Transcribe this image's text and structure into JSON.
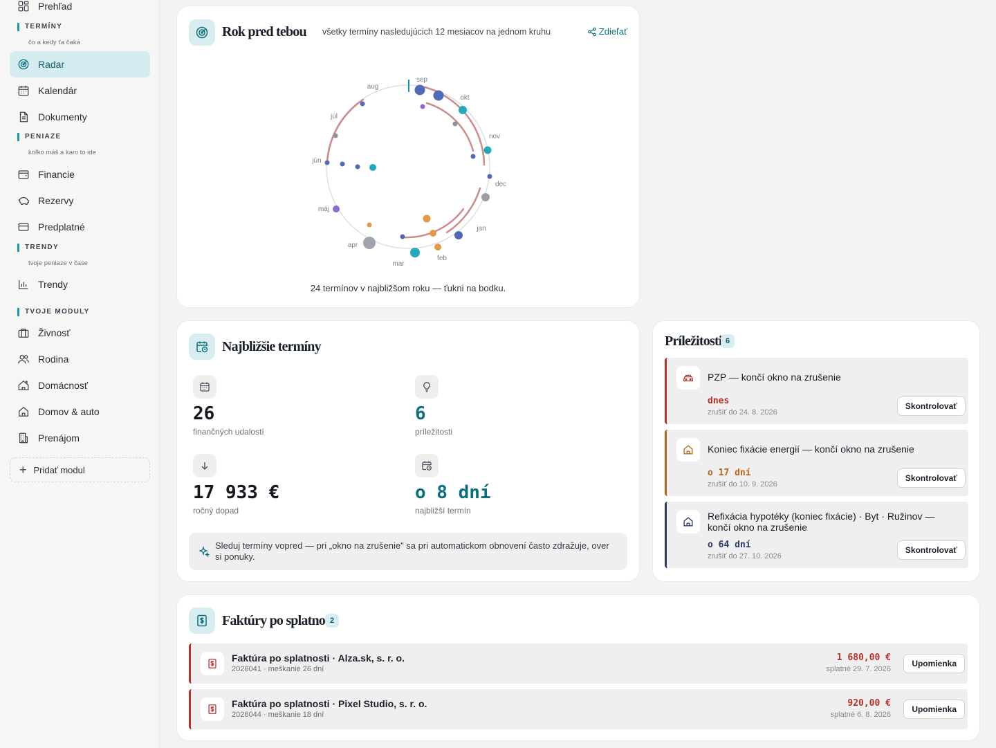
{
  "sidebar": {
    "top_item": "Prehľad",
    "sections": [
      {
        "head": "TERMÍNY",
        "sub": "čo a kedy ťa čaká"
      },
      {
        "head": "PENIAZE",
        "sub": "koľko máš a kam to ide"
      },
      {
        "head": "TRENDY",
        "sub": "tvoje peniaze v čase"
      },
      {
        "head": "TVOJE MODULY"
      }
    ],
    "items": {
      "radar": "Radar",
      "kalendar": "Kalendár",
      "dokumenty": "Dokumenty",
      "financie": "Financie",
      "rezervy": "Rezervy",
      "predplatne": "Predplatné",
      "trendy": "Trendy",
      "zivnost": "Živnosť",
      "rodina": "Rodina",
      "domacnost": "Domácnosť",
      "domov_auto": "Domov & auto",
      "prenajom": "Prenájom"
    },
    "add_module": "Pridať modul"
  },
  "radar": {
    "title": "Rok pred tebou",
    "subtitle": "všetky termíny nasledujúcich 12 mesiacov na jednom kruhu",
    "share": "Zdieľať",
    "months": [
      "sep",
      "okt",
      "nov",
      "dec",
      "jan",
      "feb",
      "mar",
      "apr",
      "máj",
      "jún",
      "júl",
      "aug"
    ],
    "caption": "24 termínov v najbližšom roku — ťukni na bodku."
  },
  "chart_data": {
    "type": "scatter",
    "title": "Rok pred tebou",
    "start_month": "sep",
    "months": [
      "sep",
      "okt",
      "nov",
      "dec",
      "jan",
      "feb",
      "mar",
      "apr",
      "máj",
      "jún",
      "júl",
      "aug"
    ],
    "total_points": 24
  },
  "upcoming": {
    "title": "Najbližšie termíny",
    "stats": [
      {
        "value": "26",
        "label": "finančných udalostí"
      },
      {
        "value": "6",
        "label": "príležitosti"
      },
      {
        "value": "17 933 €",
        "label": "ročný dopad"
      },
      {
        "value": "o 8 dní",
        "label": "najbližší termín"
      }
    ],
    "tip": "Sleduj termíny vopred — pri „okno na zrušenie\" sa pri automatickom obnovení často zdražuje, over si ponuky."
  },
  "opportunities": {
    "title": "Príležitosti",
    "count": "6",
    "items": [
      {
        "title": "PZP — končí okno na zrušenie",
        "when": "dnes",
        "date": "zrušiť do 24. 8. 2026",
        "button": "Skontrolovať",
        "color": "#b6312a",
        "icon": "car-icon"
      },
      {
        "title": "Koniec fixácie energií — končí okno na zrušenie",
        "when": "o 17 dní",
        "date": "zrušiť do 10. 9. 2026",
        "button": "Skontrolovať",
        "color": "#b8651c",
        "icon": "home-icon"
      },
      {
        "title": "Refixácia hypotéky (koniec fixácie) · Byt · Ružinov — končí okno na zrušenie",
        "when": "o 64 dní",
        "date": "zrušiť do 27. 10. 2026",
        "button": "Skontrolovať",
        "color": "#2e3a66",
        "icon": "home-icon"
      }
    ]
  },
  "invoices": {
    "title": "Faktúry po splatnosti",
    "count": "2",
    "items": [
      {
        "title": "Faktúra po splatnosti · Alza.sk, s. r. o.",
        "sub": "2026041 · meškanie 26 dní",
        "amount": "1 680,00 €",
        "due": "splatné 29. 7. 2026",
        "button": "Upomienka"
      },
      {
        "title": "Faktúra po splatnosti · Pixel Studio, s. r. o.",
        "sub": "2026044 · meškanie 18 dní",
        "amount": "920,00 €",
        "due": "splatné 6. 8. 2026",
        "button": "Upomienka"
      }
    ]
  },
  "colors": {
    "accent": "#0d6e7e",
    "accent_bg": "#d7edf0",
    "overdue": "#b6312a",
    "warning": "#b8651c",
    "navy": "#2e3a66"
  }
}
